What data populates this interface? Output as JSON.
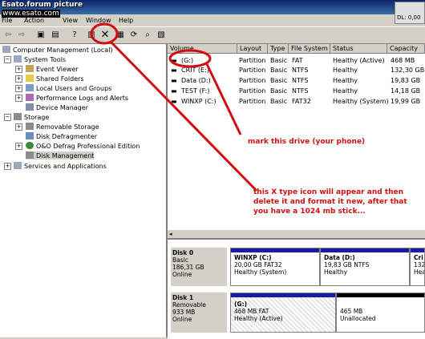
{
  "watermark": {
    "line1": "Esato.forum picture",
    "line2": "www.esato.com"
  },
  "dl_box": {
    "text": "DL: 0,00"
  },
  "menu": [
    "File",
    "Action",
    "View",
    "Window",
    "Help"
  ],
  "tree": {
    "root": "Computer Management (Local)",
    "system_tools": "System Tools",
    "event_viewer": "Event Viewer",
    "shared_folders": "Shared Folders",
    "local_users": "Local Users and Groups",
    "perf_logs": "Performance Logs and Alerts",
    "device_manager": "Device Manager",
    "storage": "Storage",
    "removable": "Removable Storage",
    "defrag": "Disk Defragmenter",
    "oo_defrag": "O&O Defrag Professional Edition",
    "disk_mgmt": "Disk Management",
    "services": "Services and Applications"
  },
  "columns": [
    "Volume",
    "Layout",
    "Type",
    "File System",
    "Status",
    "Capacity"
  ],
  "volumes": [
    [
      "(G:)",
      "Partition",
      "Basic",
      "FAT",
      "Healthy (Active)",
      "468 MB"
    ],
    [
      "CRIT (E:)",
      "Partition",
      "Basic",
      "NTFS",
      "Healthy",
      "132,30 GB"
    ],
    [
      "Data (D:)",
      "Partition",
      "Basic",
      "NTFS",
      "Healthy",
      "19,83 GB"
    ],
    [
      "TEST (F:)",
      "Partition",
      "Basic",
      "NTFS",
      "Healthy",
      "14,18 GB"
    ],
    [
      "WINXP (C:)",
      "Partition",
      "Basic",
      "FAT32",
      "Healthy (System)",
      "19,99 GB"
    ]
  ],
  "disk0": {
    "name": "Disk 0",
    "type": "Basic",
    "size": "186,31 GB",
    "status": "Online",
    "p1": {
      "name": "WINXP  (C:)",
      "size": "20,00 GB FAT32",
      "status": "Healthy (System)"
    },
    "p2": {
      "name": "Data  (D:)",
      "size": "19,83 GB NTFS",
      "status": "Healthy"
    },
    "p3": {
      "name": "Cri",
      "size": "132",
      "status": "Hea"
    }
  },
  "disk1": {
    "name": "Disk 1",
    "type": "Removable",
    "size": "933 MB",
    "status": "Online",
    "p1": {
      "name": "(G:)",
      "size": "468 MB FAT",
      "status": "Healthy (Active)"
    },
    "p2": {
      "size": "465 MB",
      "status": "Unallocated"
    }
  },
  "annotations": {
    "mark": "mark this drive (your phone)",
    "delete1": "this X type icon will appear and then",
    "delete2": "delete it and format it new, after that",
    "delete3": "you have a 1024 mb stick..."
  },
  "colors": {
    "annotation": "#d01010",
    "partition_bar": "#1a1aa8"
  }
}
